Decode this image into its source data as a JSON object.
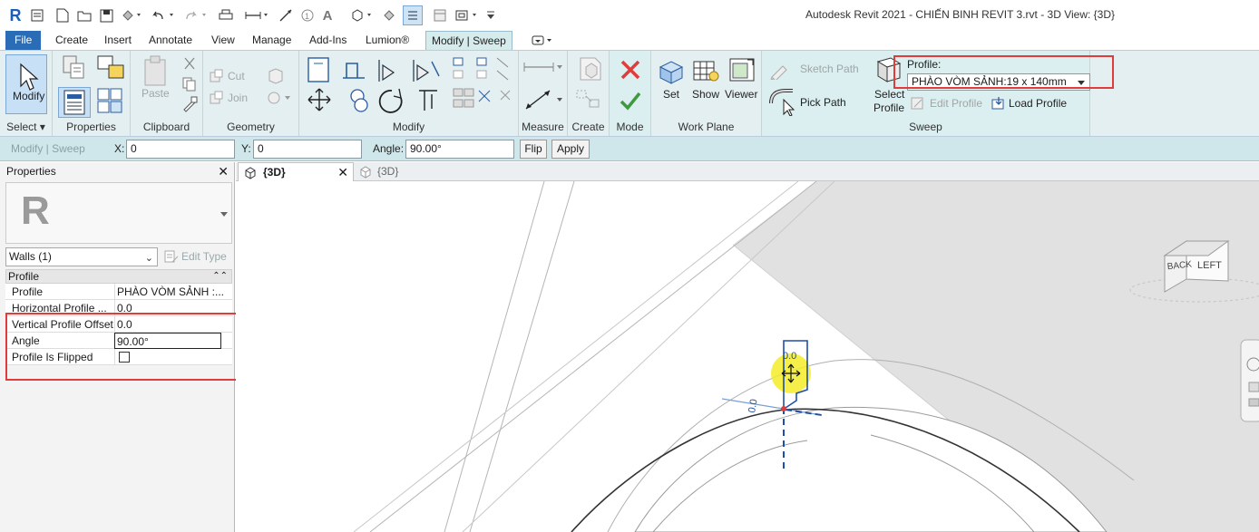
{
  "app": {
    "logo": "R",
    "title": "Autodesk Revit 2021 - CHIẾN BINH REVIT 3.rvt - 3D View: {3D}"
  },
  "tabs": [
    {
      "label": "File"
    },
    {
      "label": "Create"
    },
    {
      "label": "Insert"
    },
    {
      "label": "Annotate"
    },
    {
      "label": "View"
    },
    {
      "label": "Manage"
    },
    {
      "label": "Add-Ins"
    },
    {
      "label": "Lumion®"
    },
    {
      "label": "Modify | Sweep"
    }
  ],
  "ribbon": {
    "modify_label": "Modify",
    "select_panel": "Select ▾",
    "properties_panel": "Properties",
    "clipboard_panel": "Clipboard",
    "paste_label": "Paste",
    "cut_label": "Cut",
    "join_label": "Join",
    "geometry_panel": "Geometry",
    "modify_panel": "Modify",
    "measure_panel": "Measure",
    "create_panel": "Create",
    "mode_panel": "Mode",
    "workplane_panel": "Work Plane",
    "set_label": "Set",
    "show_label": "Show",
    "viewer_label": "Viewer",
    "sweep_panel": "Sweep",
    "sketch_path_label": "Sketch Path",
    "pick_path_label": "Pick Path",
    "select_profile_label_1": "Select",
    "select_profile_label_2": "Profile",
    "profile_caption": "Profile:",
    "profile_value": "PHÀO VÒM SẢNH:19 x 140mm",
    "edit_profile_label": "Edit Profile",
    "load_profile_label": "Load Profile"
  },
  "options_bar": {
    "context": "Modify | Sweep",
    "x_label": "X:",
    "x_value": "0",
    "y_label": "Y:",
    "y_value": "0",
    "angle_label": "Angle:",
    "angle_value": "90.00°",
    "flip_label": "Flip",
    "apply_label": "Apply"
  },
  "properties": {
    "title": "Properties",
    "selector_value": "Walls (1)",
    "edit_type_label": "Edit Type",
    "section": "Profile",
    "rows": [
      {
        "key": "Profile",
        "value": "PHÀO VÒM SẢNH :..."
      },
      {
        "key": "Horizontal Profile ...",
        "value": "0.0"
      },
      {
        "key": "Vertical Profile Offset",
        "value": "0.0"
      },
      {
        "key": "Angle",
        "value": "90.00°"
      },
      {
        "key": "Profile Is Flipped",
        "value": ""
      }
    ]
  },
  "view_tabs": [
    {
      "label": "{3D}"
    },
    {
      "label": "{3D}"
    }
  ],
  "viewcube": {
    "back_label": "BACK",
    "left_label": "LEFT"
  },
  "canvas_labels": {
    "offset_value": "0.0",
    "rotated_value": "0.0"
  },
  "colors": {
    "accent": "#2b6cb6",
    "ribbon_bg": "#e4eff1",
    "highlight": "#e03c3c",
    "cursor_glow": "#f4ec2a"
  }
}
